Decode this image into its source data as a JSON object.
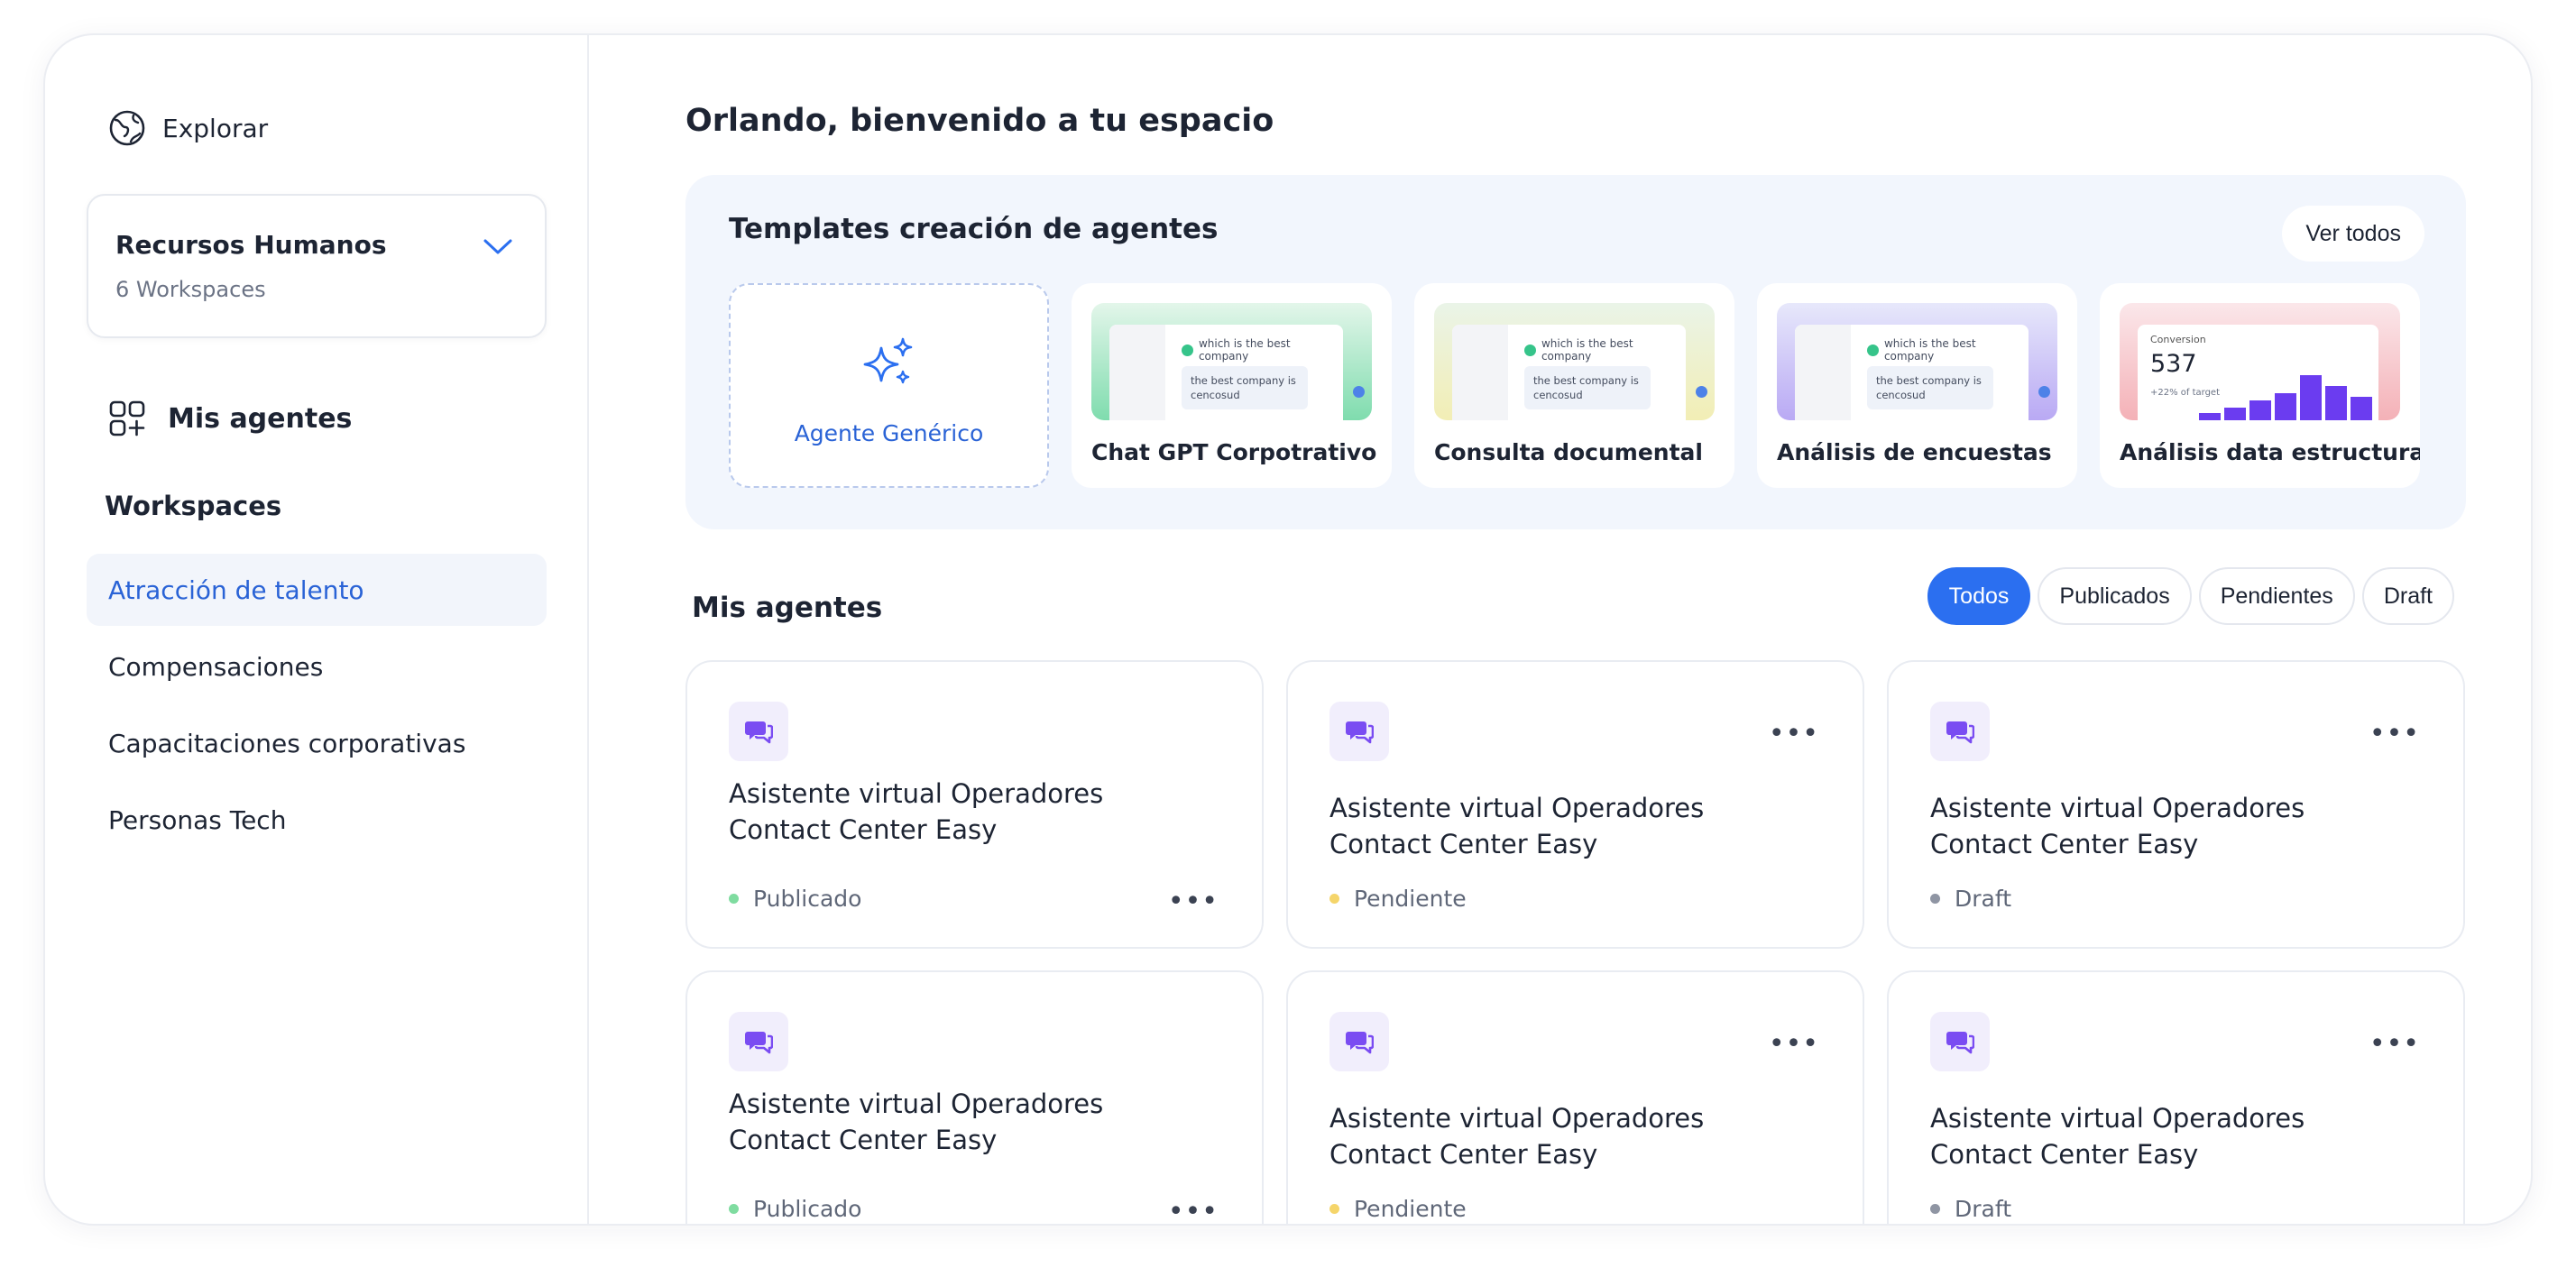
{
  "sidebar": {
    "explore_label": "Explorar",
    "workspace_selector": {
      "name": "Recursos Humanos",
      "count": "6 Workspaces"
    },
    "my_agents_label": "Mis agentes",
    "workspaces_heading": "Workspaces",
    "workspaces": [
      {
        "label": "Atracción de talento",
        "active": true
      },
      {
        "label": "Compensaciones",
        "active": false
      },
      {
        "label": "Capacitaciones corporativas",
        "active": false
      },
      {
        "label": "Personas Tech",
        "active": false
      }
    ]
  },
  "main": {
    "greeting": "Orlando, bienvenido a tu espacio",
    "templates": {
      "title": "Templates creación de agentes",
      "see_all": "Ver todos",
      "generic_label": "Agente Genérico",
      "items": [
        {
          "label": "Chat GPT Corpotrativo",
          "question": "which is the best company",
          "answer": "the best company is cencosud",
          "gradient": [
            "#e3f6ea",
            "#7fdcae"
          ]
        },
        {
          "label": "Consulta documental",
          "question": "which is the best company",
          "answer": "the best company is cencosud",
          "gradient": [
            "#eaf4e8",
            "#f2eeb5"
          ]
        },
        {
          "label": "Análisis de encuestas",
          "question": "which is the best company",
          "answer": "the best company is cencosud",
          "gradient": [
            "#e7e8fb",
            "#b9a9f4"
          ]
        },
        {
          "label": "Análisis data estructurada",
          "conversion_label": "Conversion",
          "conversion_value": "537",
          "target_label": "+22% of target",
          "gradient": [
            "#fbe7ea",
            "#f4b1b7"
          ]
        }
      ]
    },
    "my_agents": {
      "title": "Mis agentes",
      "filters": [
        {
          "label": "Todos",
          "active": true
        },
        {
          "label": "Publicados",
          "active": false
        },
        {
          "label": "Pendientes",
          "active": false
        },
        {
          "label": "Draft",
          "active": false
        }
      ],
      "agents": [
        {
          "title": "Asistente virtual Operadores Contact Center Easy",
          "status": "Publicado",
          "status_color": "#7fdca0"
        },
        {
          "title": "Asistente virtual Operadores Contact Center Easy",
          "status": "Pendiente",
          "status_color": "#f5d56a"
        },
        {
          "title": "Asistente virtual Operadores Contact Center Easy",
          "status": "Draft",
          "status_color": "#8f95a3"
        },
        {
          "title": "Asistente virtual Operadores Contact Center Easy",
          "status": "Publicado",
          "status_color": "#7fdca0"
        },
        {
          "title": "Asistente virtual Operadores Contact Center Easy",
          "status": "Pendiente",
          "status_color": "#f5d56a"
        },
        {
          "title": "Asistente virtual Operadores Contact Center Easy",
          "status": "Draft",
          "status_color": "#8f95a3"
        }
      ]
    }
  },
  "colors": {
    "accent": "#2b6ff0",
    "panel_bg": "#f2f6fd",
    "active_item_bg": "#f2f5fb"
  },
  "icons": {
    "explore": "globe-icon",
    "workspace_chevron": "chevron-down-icon",
    "agents_nav": "grid-plus-icon",
    "generic": "sparkles-icon",
    "agent": "chat-bubbles-icon",
    "more": "more-horizontal-icon"
  }
}
